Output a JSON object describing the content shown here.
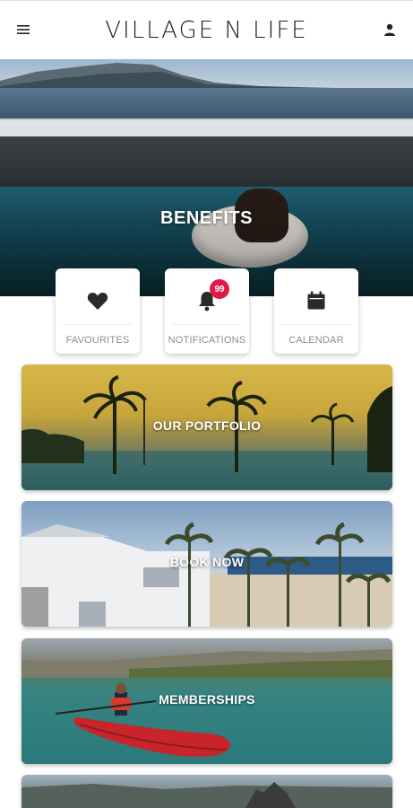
{
  "header": {
    "title": "VILLAGE N LIFE",
    "menu_icon": "hamburger-menu-icon",
    "profile_icon": "user-icon"
  },
  "hero": {
    "label": "BENEFITS"
  },
  "quick_actions": [
    {
      "label": "FAVOURITES",
      "icon": "heart-icon"
    },
    {
      "label": "NOTIFICATIONS",
      "icon": "bell-icon",
      "badge": "99"
    },
    {
      "label": "CALENDAR",
      "icon": "calendar-icon"
    }
  ],
  "tiles": [
    {
      "label": "OUR PORTFOLIO"
    },
    {
      "label": "BOOK NOW"
    },
    {
      "label": "MEMBERSHIPS"
    }
  ],
  "colors": {
    "badge": "#e01a46",
    "label_text": "#8d8d8d",
    "title_text": "#222222"
  }
}
